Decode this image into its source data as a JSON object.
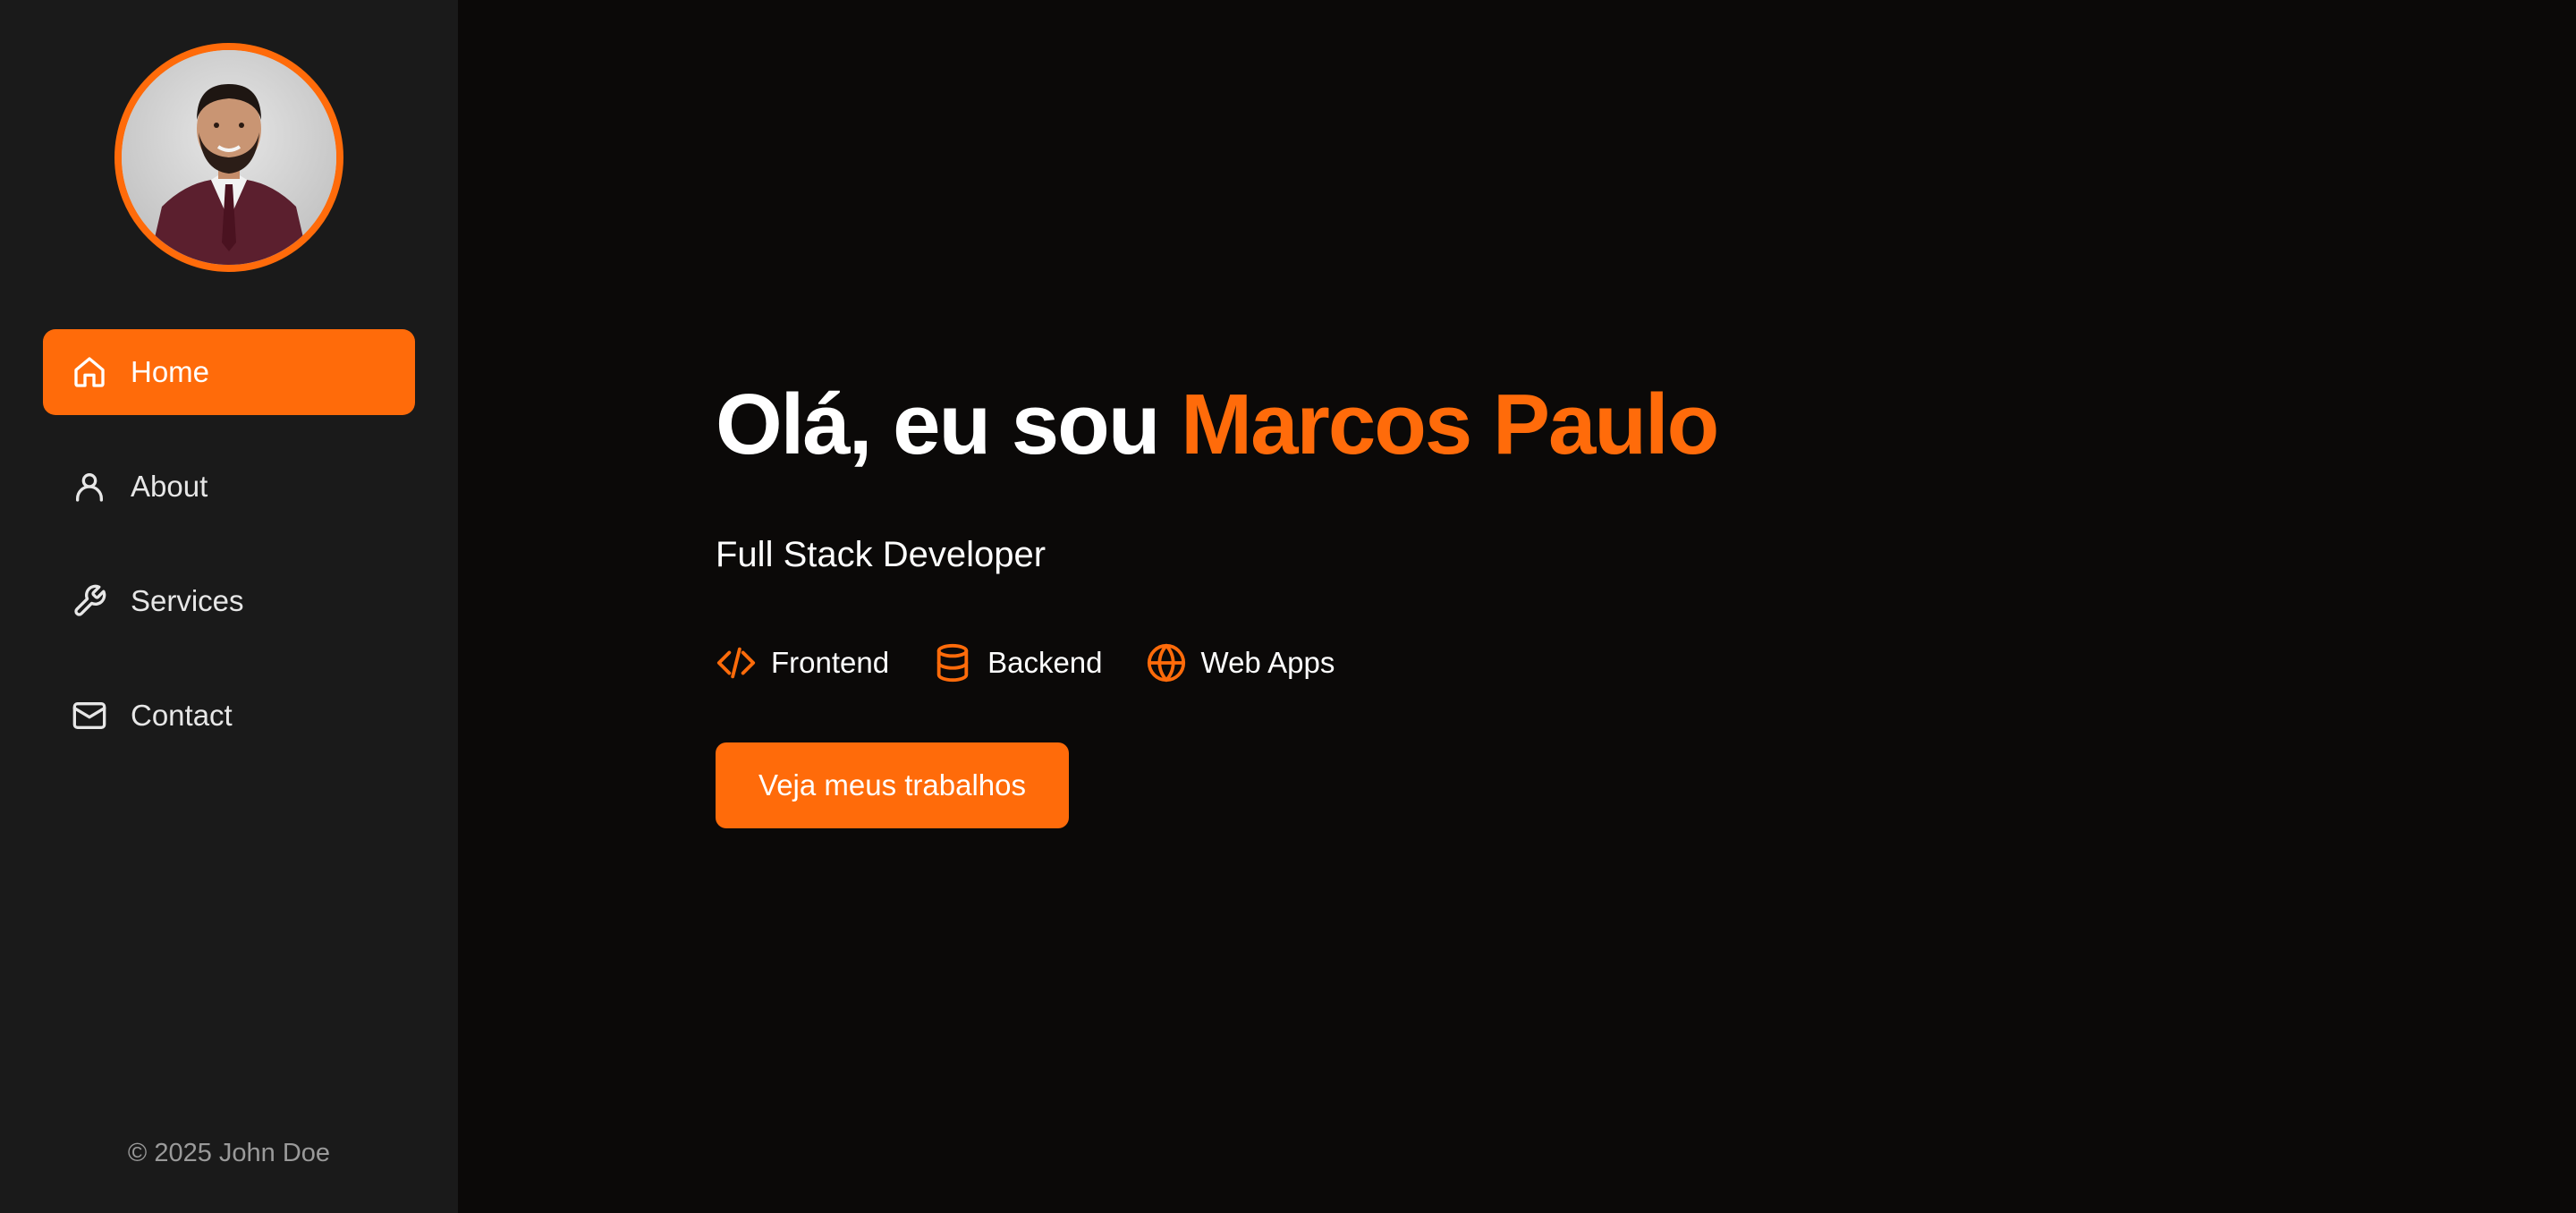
{
  "colors": {
    "accent": "#ff6b0a",
    "sidebar_bg": "#1a1a1a",
    "main_bg": "#0b0908"
  },
  "sidebar": {
    "nav": [
      {
        "label": "Home",
        "icon": "home-icon",
        "active": true
      },
      {
        "label": "About",
        "icon": "user-icon",
        "active": false
      },
      {
        "label": "Services",
        "icon": "wrench-icon",
        "active": false
      },
      {
        "label": "Contact",
        "icon": "mail-icon",
        "active": false
      }
    ],
    "footer": "© 2025 John Doe"
  },
  "hero": {
    "greeting": "Olá, eu sou ",
    "name": "Marcos Paulo",
    "subtitle": "Full Stack Developer",
    "skills": [
      {
        "label": "Frontend",
        "icon": "code-icon"
      },
      {
        "label": "Backend",
        "icon": "database-icon"
      },
      {
        "label": "Web Apps",
        "icon": "globe-icon"
      }
    ],
    "cta": "Veja meus trabalhos"
  }
}
